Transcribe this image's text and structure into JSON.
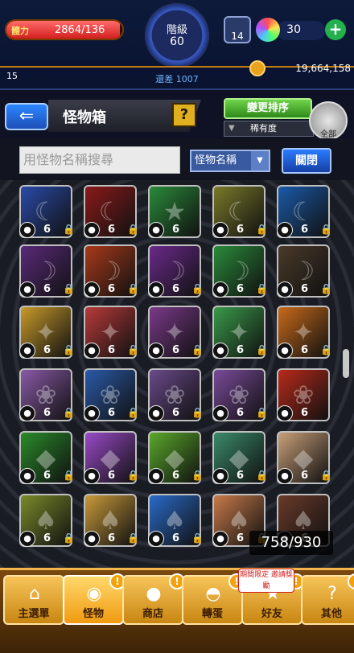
{
  "top": {
    "stamina_label": "體力",
    "stamina_value": "2864/136",
    "stamina_fill_pct": 98,
    "rank_label": "階級",
    "rank_value": "60",
    "exp_remaining": "還差 1007",
    "shop_count": "14",
    "orb_count": "30",
    "plus_label": "+",
    "left_number": "15",
    "gold": "19,664,158"
  },
  "header": {
    "back_arrow": "⇐",
    "title": "怪物箱",
    "help_label": "?",
    "sort_button": "變更排序",
    "sort_field": "稀有度",
    "filter_icon": "▼",
    "all_button": "全部"
  },
  "search": {
    "placeholder": "用怪物名稱搜尋",
    "select_value": "怪物名稱",
    "select_arrow": "▼",
    "close_button": "關閉"
  },
  "box_count": "758/930",
  "monsters": [
    {
      "lvl": "6",
      "elem": "●",
      "bg": "#2a4aa8",
      "glyph": "☾",
      "locked": "🔒"
    },
    {
      "lvl": "6",
      "elem": "●",
      "bg": "#8a1a1a",
      "glyph": "☾",
      "locked": "🔒"
    },
    {
      "lvl": "6",
      "elem": "●",
      "bg": "#2a8a3a",
      "glyph": "★",
      "locked": ""
    },
    {
      "lvl": "6",
      "elem": "●",
      "bg": "#7a7a2a",
      "glyph": "☾",
      "locked": "🔒"
    },
    {
      "lvl": "6",
      "elem": "●",
      "bg": "#1a5aa8",
      "glyph": "☾",
      "locked": "🔒"
    },
    {
      "lvl": "6",
      "elem": "●",
      "bg": "#5a2a7a",
      "glyph": "☽",
      "locked": "🔒"
    },
    {
      "lvl": "6",
      "elem": "●",
      "bg": "#a83a1a",
      "glyph": "☽",
      "locked": "🔒"
    },
    {
      "lvl": "6",
      "elem": "●",
      "bg": "#6a2a8a",
      "glyph": "☽",
      "locked": "🔒"
    },
    {
      "lvl": "6",
      "elem": "●",
      "bg": "#2a8a3a",
      "glyph": "☽",
      "locked": "🔒"
    },
    {
      "lvl": "6",
      "elem": "●",
      "bg": "#4a3a2a",
      "glyph": "☽",
      "locked": "🔒"
    },
    {
      "lvl": "6",
      "elem": "●",
      "bg": "#c89a2a",
      "glyph": "✦",
      "locked": "🔒"
    },
    {
      "lvl": "6",
      "elem": "●",
      "bg": "#b83a3a",
      "glyph": "✦",
      "locked": "🔒"
    },
    {
      "lvl": "6",
      "elem": "●",
      "bg": "#7a3a8a",
      "glyph": "✦",
      "locked": "🔒"
    },
    {
      "lvl": "6",
      "elem": "●",
      "bg": "#3a9a4a",
      "glyph": "✦",
      "locked": "🔒"
    },
    {
      "lvl": "6",
      "elem": "●",
      "bg": "#c86a1a",
      "glyph": "✦",
      "locked": "🔒"
    },
    {
      "lvl": "6",
      "elem": "●",
      "bg": "#8a5aa8",
      "glyph": "❀",
      "locked": "🔒"
    },
    {
      "lvl": "6",
      "elem": "●",
      "bg": "#2a5aa8",
      "glyph": "❀",
      "locked": "🔒"
    },
    {
      "lvl": "6",
      "elem": "●",
      "bg": "#6a4a8a",
      "glyph": "❀",
      "locked": "🔒"
    },
    {
      "lvl": "6",
      "elem": "●",
      "bg": "#7a4a9a",
      "glyph": "❀",
      "locked": "🔒"
    },
    {
      "lvl": "6",
      "elem": "●",
      "bg": "#b82a1a",
      "glyph": "❀",
      "locked": ""
    },
    {
      "lvl": "6",
      "elem": "●",
      "bg": "#2a8a2a",
      "glyph": "◆",
      "locked": "🔒"
    },
    {
      "lvl": "6",
      "elem": "●",
      "bg": "#9a4ac8",
      "glyph": "◆",
      "locked": "🔒"
    },
    {
      "lvl": "6",
      "elem": "●",
      "bg": "#5aa82a",
      "glyph": "◆",
      "locked": "🔒"
    },
    {
      "lvl": "6",
      "elem": "●",
      "bg": "#3a8a6a",
      "glyph": "◆",
      "locked": "🔒"
    },
    {
      "lvl": "6",
      "elem": "●",
      "bg": "#c8a07a",
      "glyph": "◆",
      "locked": "🔒"
    },
    {
      "lvl": "6",
      "elem": "●",
      "bg": "#7a8a2a",
      "glyph": "♠",
      "locked": "🔒"
    },
    {
      "lvl": "6",
      "elem": "●",
      "bg": "#c89a3a",
      "glyph": "♠",
      "locked": "🔒"
    },
    {
      "lvl": "6",
      "elem": "●",
      "bg": "#2a6ac8",
      "glyph": "♠",
      "locked": "🔒"
    },
    {
      "lvl": "6",
      "elem": "●",
      "bg": "#c87a4a",
      "glyph": "♠",
      "locked": "🔒"
    },
    {
      "lvl": "6",
      "elem": "●",
      "bg": "#6a3a2a",
      "glyph": "♠",
      "locked": ""
    }
  ],
  "nav": [
    {
      "label": "主選單",
      "icon": "⌂",
      "badge": ""
    },
    {
      "label": "怪物",
      "icon": "◉",
      "badge": "!"
    },
    {
      "label": "商店",
      "icon": "●",
      "badge": "!"
    },
    {
      "label": "轉蛋",
      "icon": "◓",
      "badge": "!"
    },
    {
      "label": "好友",
      "icon": "★",
      "badge": "!"
    },
    {
      "label": "其他",
      "icon": "?",
      "badge": "!"
    }
  ],
  "limited_tag": "期間限定 邀請獎勵"
}
